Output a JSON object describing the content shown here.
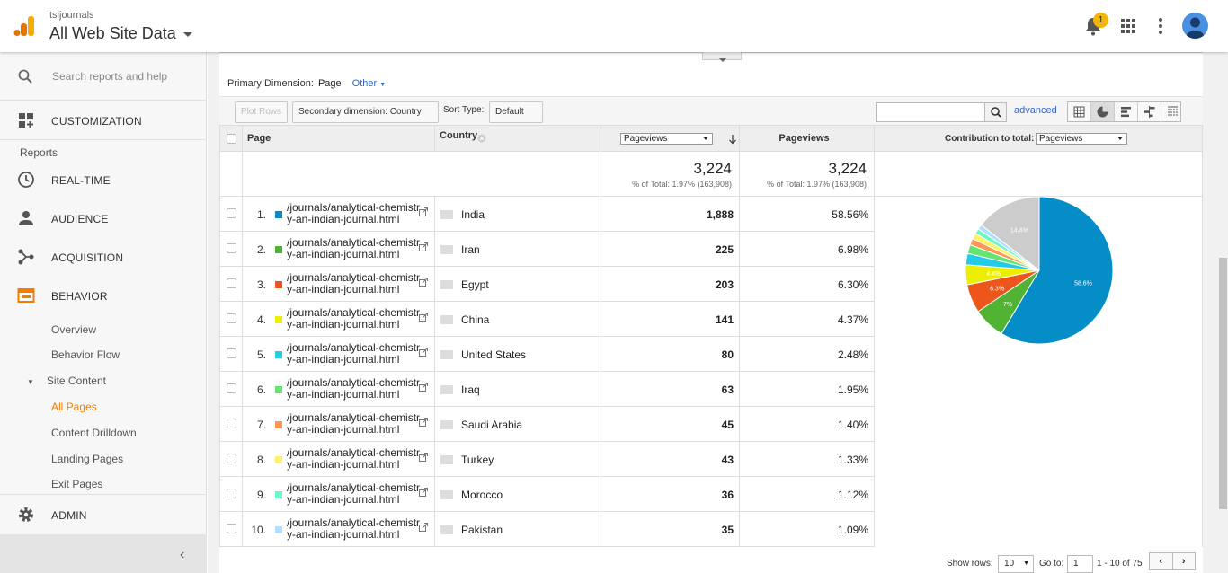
{
  "header": {
    "account_small": "tsijournals",
    "account_title": "All Web Site Data",
    "notification_count": "1"
  },
  "sidebar": {
    "search_placeholder": "Search reports and help",
    "customization": "CUSTOMIZATION",
    "reports_label": "Reports",
    "realtime": "REAL-TIME",
    "audience": "AUDIENCE",
    "acquisition": "ACQUISITION",
    "behavior": "BEHAVIOR",
    "behavior_items": [
      "Overview",
      "Behavior Flow"
    ],
    "site_content_group": "Site Content",
    "site_content_items": [
      "All Pages",
      "Content Drilldown",
      "Landing Pages",
      "Exit Pages"
    ],
    "admin": "ADMIN"
  },
  "controls": {
    "primary_dimension_label": "Primary Dimension:",
    "primary_dimension_value": "Page",
    "other_label": "Other",
    "plot_rows": "Plot Rows",
    "secondary_dimension": "Secondary dimension: Country",
    "sort_type_label": "Sort Type:",
    "sort_type_value": "Default",
    "search_value": "",
    "advanced": "advanced"
  },
  "table": {
    "col_page": "Page",
    "col_country": "Country",
    "metric_select_1": "Pageviews",
    "col_pageviews": "Pageviews",
    "contribution_label": "Contribution to total:",
    "metric_select_2": "Pageviews",
    "total_value_1": "3,224",
    "total_sub_1": "% of Total: 1.97% (163,908)",
    "total_value_2": "3,224",
    "total_sub_2": "% of Total: 1.97% (163,908)",
    "rows": [
      {
        "num": "1.",
        "page": "/journals/analytical-chemistry-an-indian-journal.html",
        "country": "India",
        "pageviews": "1,888",
        "pct": "58.56%",
        "color": "#058dc7"
      },
      {
        "num": "2.",
        "page": "/journals/analytical-chemistry-an-indian-journal.html",
        "country": "Iran",
        "pageviews": "225",
        "pct": "6.98%",
        "color": "#50b432"
      },
      {
        "num": "3.",
        "page": "/journals/analytical-chemistry-an-indian-journal.html",
        "country": "Egypt",
        "pageviews": "203",
        "pct": "6.30%",
        "color": "#ed561b"
      },
      {
        "num": "4.",
        "page": "/journals/analytical-chemistry-an-indian-journal.html",
        "country": "China",
        "pageviews": "141",
        "pct": "4.37%",
        "color": "#edef00"
      },
      {
        "num": "5.",
        "page": "/journals/analytical-chemistry-an-indian-journal.html",
        "country": "United States",
        "pageviews": "80",
        "pct": "2.48%",
        "color": "#24cbe5"
      },
      {
        "num": "6.",
        "page": "/journals/analytical-chemistry-an-indian-journal.html",
        "country": "Iraq",
        "pageviews": "63",
        "pct": "1.95%",
        "color": "#64e572"
      },
      {
        "num": "7.",
        "page": "/journals/analytical-chemistry-an-indian-journal.html",
        "country": "Saudi Arabia",
        "pageviews": "45",
        "pct": "1.40%",
        "color": "#ff9655"
      },
      {
        "num": "8.",
        "page": "/journals/analytical-chemistry-an-indian-journal.html",
        "country": "Turkey",
        "pageviews": "43",
        "pct": "1.33%",
        "color": "#fff263"
      },
      {
        "num": "9.",
        "page": "/journals/analytical-chemistry-an-indian-journal.html",
        "country": "Morocco",
        "pageviews": "36",
        "pct": "1.12%",
        "color": "#6af9c4"
      },
      {
        "num": "10.",
        "page": "/journals/analytical-chemistry-an-indian-journal.html",
        "country": "Pakistan",
        "pageviews": "35",
        "pct": "1.09%",
        "color": "#b2deff"
      }
    ]
  },
  "chart_data": {
    "type": "pie",
    "title": "",
    "categories": [
      "India",
      "Iran",
      "Egypt",
      "China",
      "United States",
      "Iraq",
      "Saudi Arabia",
      "Turkey",
      "Morocco",
      "Pakistan",
      "Other"
    ],
    "values": [
      58.56,
      6.98,
      6.3,
      4.37,
      2.48,
      1.95,
      1.4,
      1.33,
      1.12,
      1.09,
      14.4
    ],
    "colors": [
      "#058dc7",
      "#50b432",
      "#ed561b",
      "#edef00",
      "#24cbe5",
      "#64e572",
      "#ff9655",
      "#fff263",
      "#6af9c4",
      "#b2deff",
      "#cccccc"
    ],
    "slice_labels": [
      "58.6%",
      "7%",
      "6.3%",
      "4.4%",
      "",
      "",
      "",
      "",
      "",
      "",
      "14.4%"
    ]
  },
  "footer": {
    "show_rows_label": "Show rows:",
    "show_rows_value": "10",
    "goto_label": "Go to:",
    "goto_value": "1",
    "range": "1 - 10 of 75"
  }
}
